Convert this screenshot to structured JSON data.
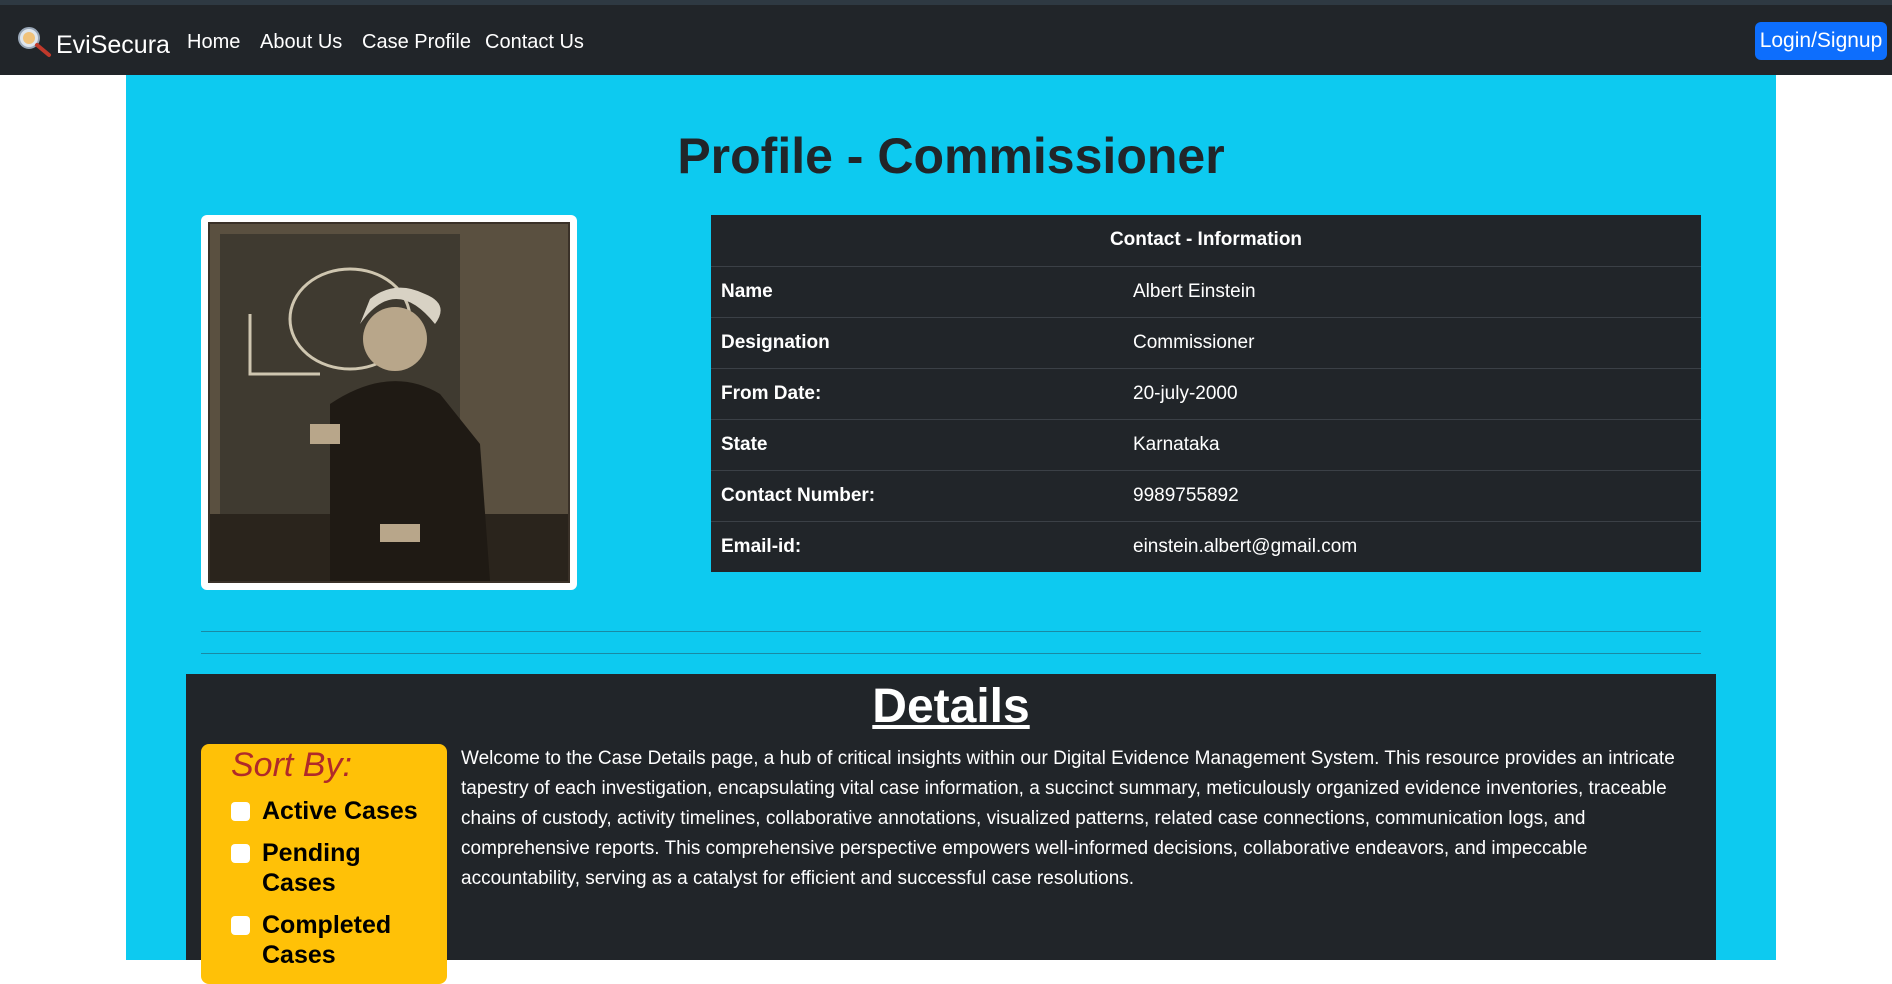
{
  "navbar": {
    "brand": "EviSecura",
    "brand_icon": "magnifier-logo-icon",
    "links": [
      "Home",
      "About Us",
      "Case Profile",
      "Contact Us"
    ],
    "login_label": "Login/Signup"
  },
  "profile": {
    "title": "Profile - Commissioner",
    "table_header": "Contact - Information",
    "rows": [
      {
        "key": "Name",
        "value": "Albert Einstein"
      },
      {
        "key": "Designation",
        "value": "Commissioner"
      },
      {
        "key": "From Date:",
        "value": "20-july-2000"
      },
      {
        "key": "State",
        "value": "Karnataka"
      },
      {
        "key": "Contact Number:",
        "value": "9989755892"
      },
      {
        "key": "Email-id:",
        "value": "einstein.albert@gmail.com"
      }
    ]
  },
  "details": {
    "title": "Details",
    "sort_title": "Sort By:",
    "sort_options": [
      "Active Cases",
      "Pending Cases",
      "Completed Cases"
    ],
    "description": "Welcome to the Case Details page, a hub of critical insights within our Digital Evidence Management System. This resource provides an intricate tapestry of each investigation, encapsulating vital case information, a succinct summary, meticulously organized evidence inventories, traceable chains of custody, activity timelines, collaborative annotations, visualized patterns, related case connections, communication logs, and comprehensive reports. This comprehensive perspective empowers well-informed decisions, collaborative endeavors, and impeccable accountability, serving as a catalyst for efficient and successful case resolutions."
  },
  "colors": {
    "navbar_bg": "#212529",
    "main_bg": "#0dcaf0",
    "accent_blue": "#0d6efd",
    "sort_bg": "#ffc107",
    "sort_title": "#b02a2a"
  }
}
